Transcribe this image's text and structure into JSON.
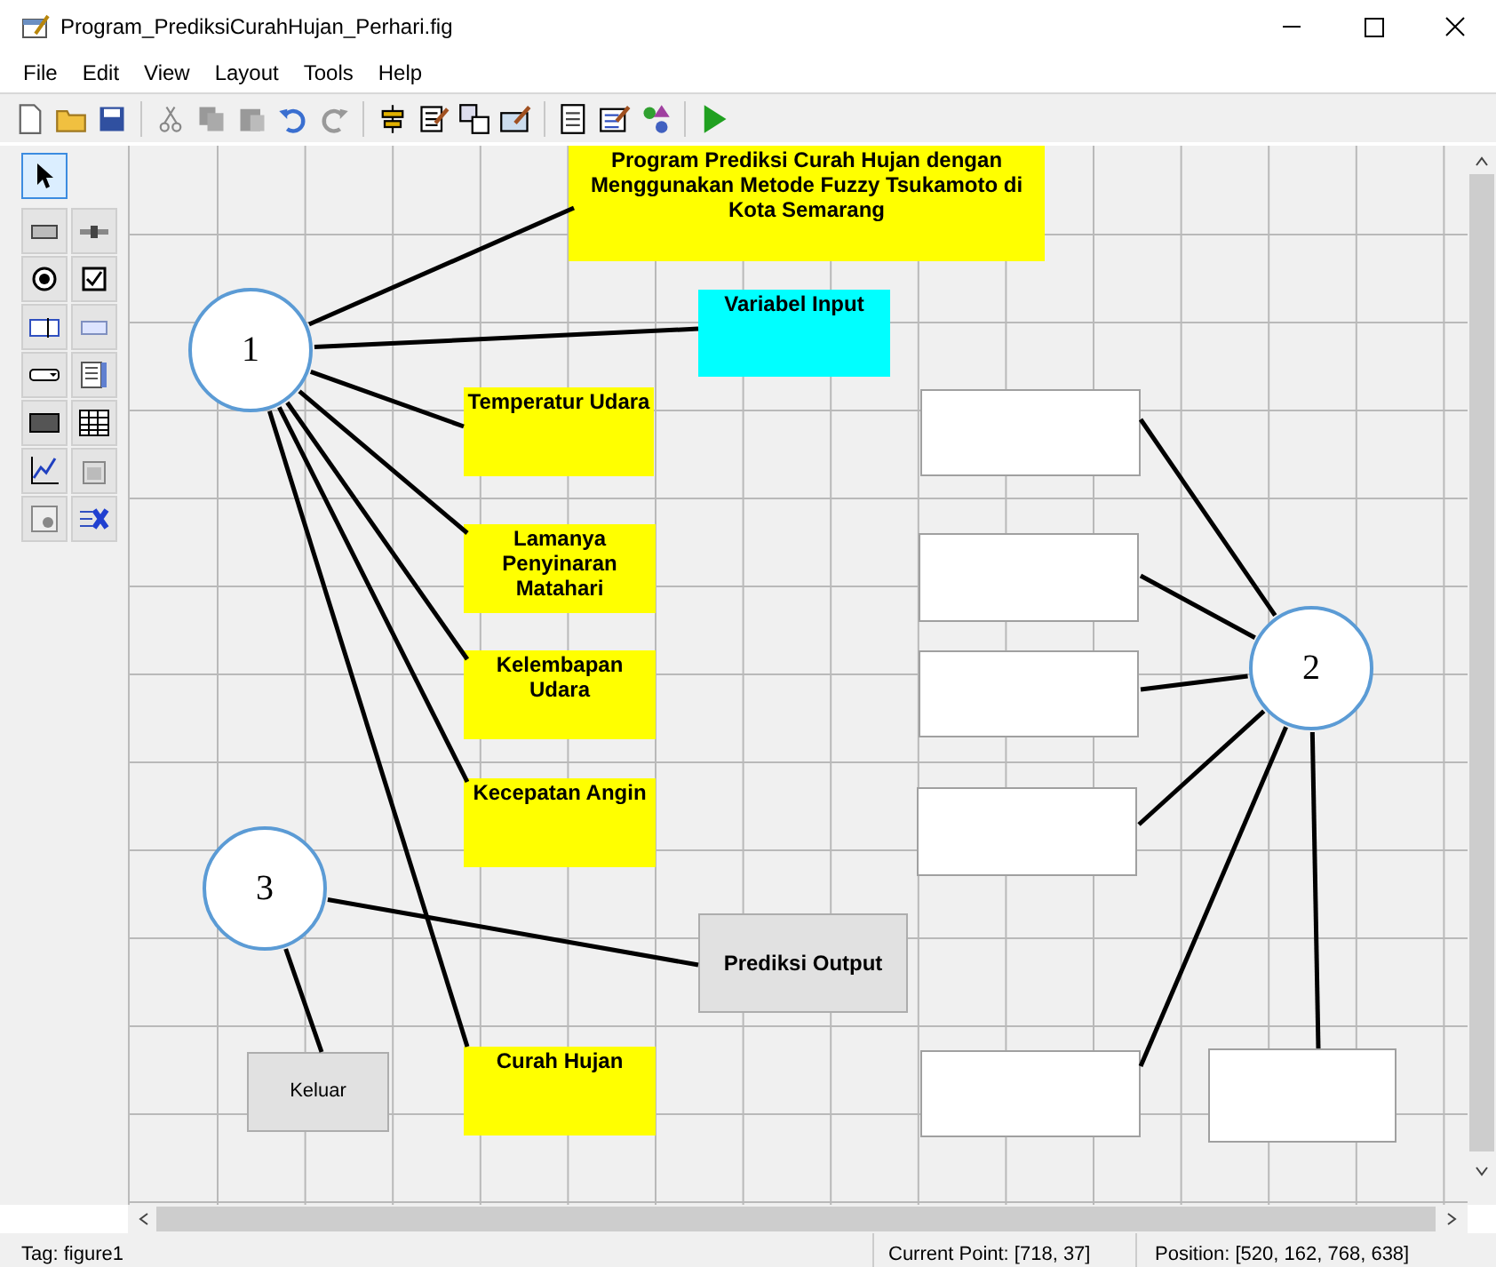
{
  "window": {
    "title": "Program_PrediksiCurahHujan_Perhari.fig"
  },
  "menu": [
    "File",
    "Edit",
    "View",
    "Layout",
    "Tools",
    "Help"
  ],
  "palette": [
    {
      "selected": true
    },
    {
      "selected": false
    },
    {
      "selected": false
    },
    {
      "selected": false
    },
    {
      "selected": false
    },
    {
      "selected": false
    },
    {
      "selected": false
    },
    {
      "selected": false
    },
    {
      "selected": false
    },
    {
      "selected": false
    },
    {
      "selected": false
    },
    {
      "selected": false
    },
    {
      "selected": false
    },
    {
      "selected": false
    },
    {
      "selected": false
    }
  ],
  "components": [
    {
      "kind": "text",
      "label": "Program Prediksi Curah Hujan dengan Menggunakan Metode Fuzzy Tsukamoto di Kota Semarang",
      "color": "#ffff00"
    },
    {
      "kind": "text",
      "label": "Variabel Input",
      "color": "#00ffff"
    },
    {
      "kind": "text",
      "label": "Temperatur Udara",
      "color": "#ffff00"
    },
    {
      "kind": "text",
      "label": "Lamanya Penyinaran Matahari",
      "color": "#ffff00"
    },
    {
      "kind": "text",
      "label": "Kelembapan Udara",
      "color": "#ffff00"
    },
    {
      "kind": "text",
      "label": "Kecepatan Angin",
      "color": "#ffff00"
    },
    {
      "kind": "text",
      "label": "Curah Hujan",
      "color": "#ffff00"
    },
    {
      "kind": "button",
      "label": "Prediksi Output"
    },
    {
      "kind": "button",
      "label": "Keluar"
    },
    {
      "kind": "edit"
    },
    {
      "kind": "edit"
    },
    {
      "kind": "edit"
    },
    {
      "kind": "edit"
    },
    {
      "kind": "edit"
    },
    {
      "kind": "edit"
    }
  ],
  "annotations": [
    "1",
    "2",
    "3"
  ],
  "status_bar": {
    "tag": "Tag: figure1",
    "current_point": "Current Point:  [718, 37]",
    "position": "Position: [520, 162, 768, 638]"
  }
}
